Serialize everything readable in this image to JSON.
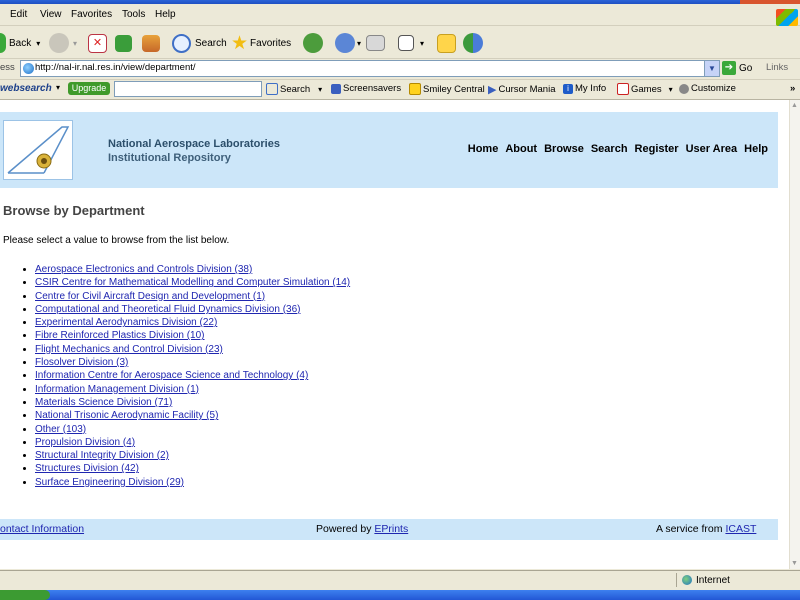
{
  "browser": {
    "menu": [
      "Edit",
      "View",
      "Favorites",
      "Tools",
      "Help"
    ],
    "toolbar": {
      "back": "Back",
      "search": "Search",
      "favorites": "Favorites"
    },
    "address": {
      "label": "ess",
      "url": "http://nal-ir.nal.res.in/view/department/",
      "go": "Go",
      "links": "Links"
    },
    "searchbar": {
      "brand": "websearch",
      "upgrade": "Upgrade",
      "search": "Search",
      "items": [
        "Screensavers",
        "Smiley Central",
        "Cursor Mania",
        "My Info",
        "Games",
        "Customize"
      ]
    },
    "status": {
      "zone": "Internet"
    }
  },
  "site": {
    "org_name": "National Aerospace Laboratories",
    "org_sub": "Institutional Repository",
    "nav": [
      "Home",
      "About",
      "Browse",
      "Search",
      "Register",
      "User Area",
      "Help"
    ]
  },
  "page": {
    "title": "Browse by Department",
    "intro": "Please select a value to browse from the list below.",
    "departments": [
      "Aerospace Electronics and Controls Division (38)",
      "CSIR Centre for Mathematical Modelling and Computer Simulation (14)",
      "Centre for Civil Aircraft Design and Development (1)",
      "Computational and Theoretical Fluid Dynamics Division (36)",
      "Experimental Aerodynamics Division (22)",
      "Fibre Reinforced Plastics Division (10)",
      "Flight Mechanics and Control Division (23)",
      "Flosolver Division (3)",
      "Information Centre for Aerospace Science and Technology (4)",
      "Information Management Division (1)",
      "Materials Science Division (71)",
      "National Trisonic Aerodynamic Facility (5)",
      "Other (103)",
      "Propulsion Division (4)",
      "Structural Integrity Division (2)",
      "Structures Division (42)",
      "Surface Engineering Division (29)"
    ]
  },
  "footer": {
    "contact": "ontact Information",
    "powered_prefix": "Powered by ",
    "powered_link": "EPrints",
    "service_prefix": "A service from ",
    "service_link": "ICAST"
  },
  "colors": {
    "header_bg": "#cce6f9",
    "link": "#1f26b0",
    "title_text": "#2c4f6b"
  }
}
